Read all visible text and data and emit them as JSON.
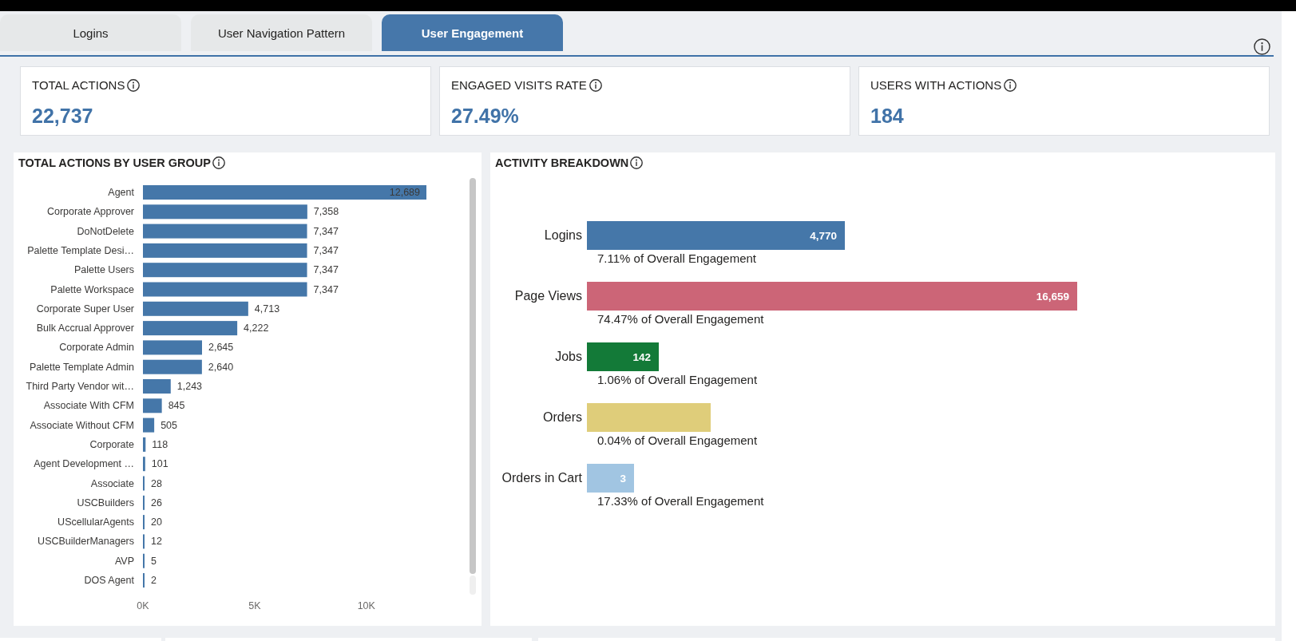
{
  "tabs": [
    {
      "label": "Logins",
      "selected": false
    },
    {
      "label": "User Navigation Pattern",
      "selected": false
    },
    {
      "label": "User Engagement",
      "selected": true
    }
  ],
  "kpis": [
    {
      "title": "TOTAL ACTIONS",
      "value": "22,737"
    },
    {
      "title": "ENGAGED VISITS RATE",
      "value": "27.49%"
    },
    {
      "title": "USERS WITH ACTIONS",
      "value": "184"
    }
  ],
  "actions_by_user_group": {
    "title": "TOTAL ACTIONS BY USER GROUP",
    "chart_data": {
      "type": "bar",
      "orientation": "horizontal",
      "categories": [
        "Agent",
        "Corporate Approver",
        "DoNotDelete",
        "Palette Template Desi…",
        "Palette Users",
        "Palette Workspace",
        "Corporate Super User",
        "Bulk Accrual Approver",
        "Corporate Admin",
        "Palette Template Admin",
        "Third Party Vendor wit…",
        "Associate With CFM",
        "Associate Without CFM",
        "Corporate",
        "Agent Development …",
        "Associate",
        "USCBuilders",
        "UScellularAgents",
        "USCBuilderManagers",
        "AVP",
        "DOS Agent"
      ],
      "values": [
        12689,
        7358,
        7347,
        7347,
        7347,
        7347,
        4713,
        4222,
        2645,
        2640,
        1243,
        845,
        505,
        118,
        101,
        28,
        26,
        20,
        12,
        5,
        2
      ],
      "value_labels": [
        "12,689",
        "7,358",
        "7,347",
        "7,347",
        "7,347",
        "7,347",
        "4,713",
        "4,222",
        "2,645",
        "2,640",
        "1,243",
        "845",
        "505",
        "118",
        "101",
        "28",
        "26",
        "20",
        "12",
        "5",
        "2"
      ],
      "xlim": [
        0,
        12689
      ],
      "xticks": [
        {
          "value": 0,
          "label": "0K"
        },
        {
          "value": 5000,
          "label": "5K"
        },
        {
          "value": 10000,
          "label": "10K"
        }
      ]
    }
  },
  "activity_breakdown": {
    "title": "ACTIVITY BREAKDOWN",
    "rows": [
      {
        "label": "Logins",
        "value": "4,770",
        "caption": "7.11% of Overall Engagement",
        "color": "#4577a9"
      },
      {
        "label": "Page Views",
        "value": "16,659",
        "caption": "74.47% of Overall Engagement",
        "color": "#cc6577"
      },
      {
        "label": "Jobs",
        "value": "142",
        "caption": "1.06% of Overall Engagement",
        "color": "#137a38"
      },
      {
        "label": "Orders",
        "caption": "0.04% of Overall Engagement",
        "color": "#dfcd7a"
      },
      {
        "label": "Orders in Cart",
        "value": "3",
        "caption": "17.33% of Overall Engagement",
        "color": "#a1c5e2"
      }
    ]
  }
}
